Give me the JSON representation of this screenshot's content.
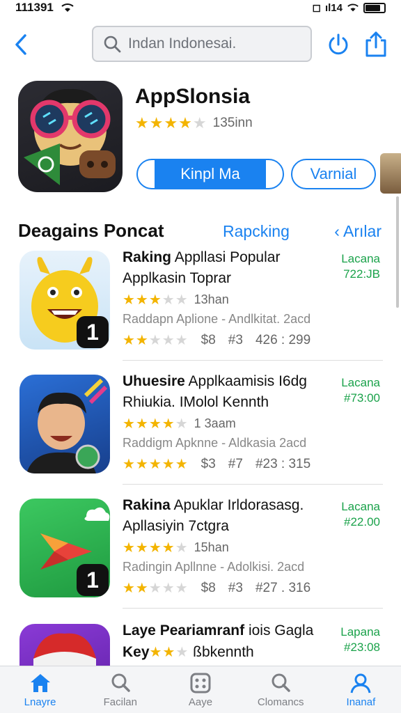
{
  "status": {
    "time": "111391",
    "signal": "ıl14",
    "box": "◻"
  },
  "search": {
    "placeholder": "Indan Indonesai."
  },
  "app": {
    "title": "AppSlonsia",
    "rating_count": "135inn",
    "rating": 4.5,
    "primary_button": "Kinpl Ma",
    "secondary_button": "Varnial"
  },
  "section": {
    "title": "Deagains Poncat",
    "link": "Rapcking",
    "nav": "Arılar"
  },
  "items": [
    {
      "title_bold": "Raking",
      "title_rest": " Appllasi Popular",
      "subtitle": "Applkasin Toprar",
      "rating_count": "13han",
      "meta": "Raddapn Aplione - Andlkitat.    2acd",
      "stat1": "$8",
      "stat2": "#3",
      "stat3": "426 : 299",
      "price_label": "Lacana",
      "price": "722:JB",
      "rank": "1"
    },
    {
      "title_bold": "Uhuesire",
      "title_rest": " Applkaamisis I6dg",
      "subtitle": "Rhiukia. IMolol Kennth",
      "rating_count": "1 3aam",
      "meta": "Raddigm Apknne - Aldkasia  2acd",
      "stat1": "$3",
      "stat2": "#7",
      "stat3": "#23 : 315",
      "price_label": "Lacana",
      "price": "#73:00",
      "rank": ""
    },
    {
      "title_bold": "Rakina",
      "title_rest": " Apuklar Irldorasasg.",
      "subtitle": "Apllasiyin 7ctgra",
      "rating_count": "15han",
      "meta": "Radingin Apllnne - Adolkisi.    2acd",
      "stat1": "$8",
      "stat2": "#3",
      "stat3": "#27 . 316",
      "price_label": "Lacana",
      "price": "#22.00",
      "rank": "1"
    },
    {
      "title_bold": "Laye Peariamranf",
      "title_rest": " iois Gagla",
      "subtitle": "Key",
      "subtitle_rest": "ßbkennth",
      "rating_count": "",
      "meta": "",
      "stat1": "",
      "stat2": "",
      "stat3": "",
      "price_label": "Lapana",
      "price": "#23:08",
      "rank": ""
    }
  ],
  "tabs": [
    {
      "label": "Lnayre",
      "icon": "home-icon",
      "active": true
    },
    {
      "label": "Facilan",
      "icon": "search-icon",
      "active": false
    },
    {
      "label": "Aaye",
      "icon": "apps-grid-icon",
      "active": false
    },
    {
      "label": "Clomancs",
      "icon": "search-icon",
      "active": false
    },
    {
      "label": "Inanaf",
      "icon": "profile-icon",
      "active": true
    }
  ],
  "colors": {
    "accent": "#1a82f0",
    "price": "#1aa24a",
    "star": "#f3b400"
  }
}
